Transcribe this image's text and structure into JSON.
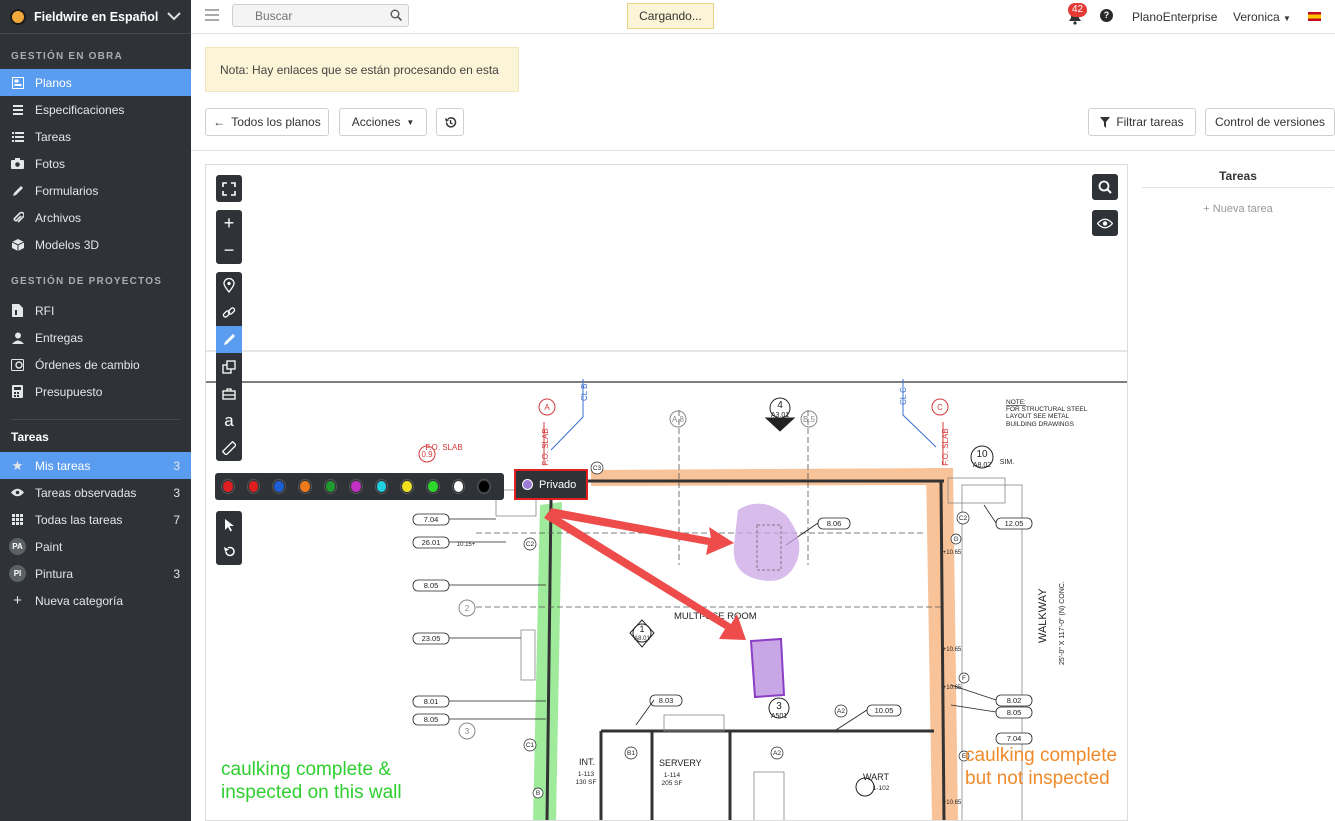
{
  "brand": {
    "name": "Fieldwire en Español"
  },
  "sidebar": {
    "section1": "GESTIÓN EN OBRA",
    "items1": [
      {
        "label": "Planos"
      },
      {
        "label": "Especificaciones"
      },
      {
        "label": "Tareas"
      },
      {
        "label": "Fotos"
      },
      {
        "label": "Formularios"
      },
      {
        "label": "Archivos"
      },
      {
        "label": "Modelos 3D"
      }
    ],
    "section2": "GESTIÓN DE PROYECTOS",
    "items2": [
      {
        "label": "RFI"
      },
      {
        "label": "Entregas"
      },
      {
        "label": "Órdenes de cambio"
      },
      {
        "label": "Presupuesto"
      }
    ],
    "section3": "Tareas",
    "items3": [
      {
        "label": "Mis tareas",
        "count": "3"
      },
      {
        "label": "Tareas observadas",
        "count": "3"
      },
      {
        "label": "Todas las tareas",
        "count": "7"
      },
      {
        "label": "Paint",
        "initials": "PA",
        "count": ""
      },
      {
        "label": "Pintura",
        "initials": "PI",
        "count": "3"
      },
      {
        "label": "Nueva categoría"
      }
    ]
  },
  "topbar": {
    "search_placeholder": "Buscar",
    "loading": "Cargando...",
    "notifications": "42",
    "help": "?",
    "company": "PlanoEnterprise",
    "user": "Veronica"
  },
  "notice": "Nota: Hay enlaces que se están procesando en esta hoja.",
  "toolbar": {
    "all_plans": "Todos los planos",
    "actions": "Acciones",
    "filter": "Filtrar tareas",
    "versions": "Control de versiones"
  },
  "tasks_panel": {
    "title": "Tareas",
    "new_task": "+ Nueva tarea"
  },
  "markup": {
    "colors": [
      "#e02020",
      "#e02020",
      "#1f5fd6",
      "#ef7a1a",
      "#1f9a2e",
      "#c430c4",
      "#1fd0e0",
      "#f0e020",
      "#2ed62e",
      "#ffffff",
      "#000000"
    ],
    "privado": "Privado",
    "text_tool": "a"
  },
  "plan": {
    "annotation_green": [
      "caulking complete &",
      "inspected on this wall"
    ],
    "annotation_orange": [
      "caulking complete",
      "but not inspected"
    ],
    "multi_room": "MULTI-USE ROOM",
    "servery": "SERVERY",
    "servery_code": "1-114",
    "servery_area": "205 SF",
    "int": "INT.",
    "int_code": "1-113",
    "int_area": "130 SF",
    "wart": "WART",
    "wart_code": "1-102",
    "walkway": "WALKWAY",
    "walkway_sub": "25'-0\" X 117'-0\" (N) CONC.",
    "note": [
      "NOTE:",
      "FOR STRUCTURAL STEEL",
      "LAYOUT SEE METAL",
      "BUILDING DRAWINGS"
    ],
    "fo_slab": "F.O. SLAB",
    "sim": "SIM.",
    "tags_left": [
      "7.04",
      "26.01",
      "8.05",
      "23.05",
      "8.01",
      "8.05"
    ],
    "tags_right": [
      "12.05",
      "8.02",
      "8.05",
      "7.04"
    ],
    "tag_center": [
      "8.06",
      "8.03",
      "10.05"
    ],
    "grid_labels": [
      "A",
      "A.8",
      "B.5",
      "C",
      "0.9",
      "2",
      "3"
    ],
    "section_num": [
      "4",
      "10",
      "1",
      "3"
    ],
    "section_ref": [
      "A3.01",
      "A8.02",
      "A8.01",
      "A501"
    ],
    "small_tags": [
      "C3",
      "C2",
      "C2",
      "C1",
      "B1",
      "A2",
      "A2",
      "B",
      "G",
      "F",
      "E"
    ],
    "cl_b": "CL B",
    "cl_c": "CL C",
    "elev": [
      "10.15+",
      "+10.65",
      "+10.65",
      "+10.65",
      "+10.65"
    ]
  }
}
